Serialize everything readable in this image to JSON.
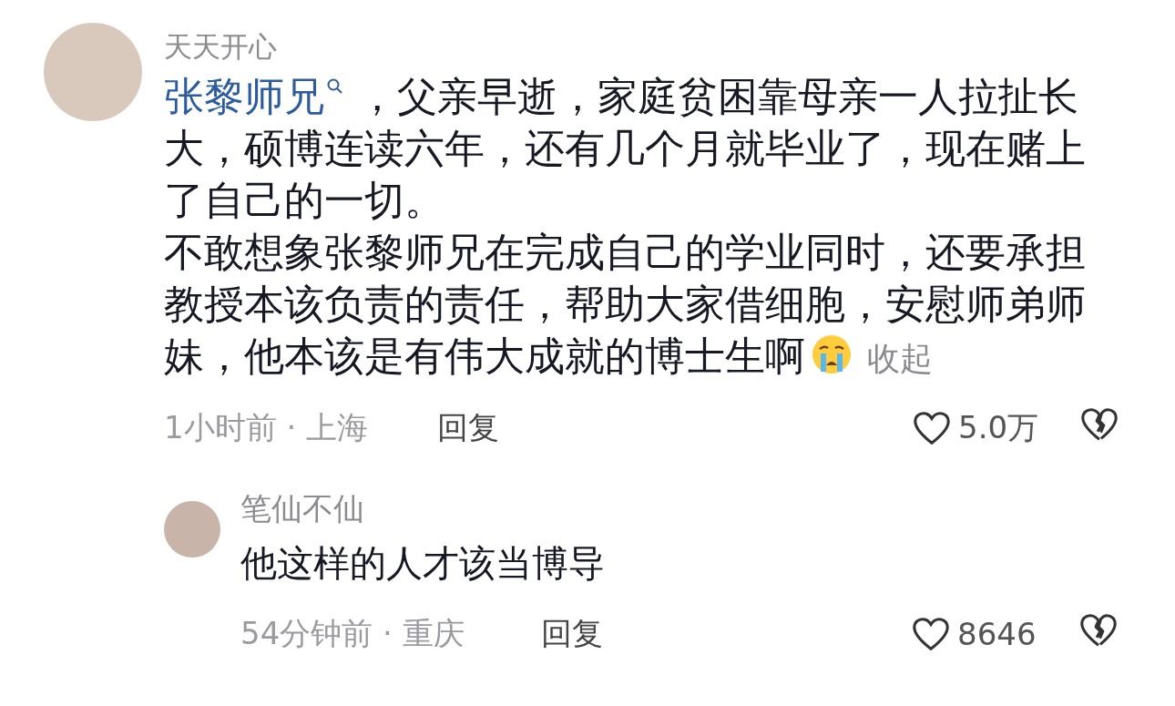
{
  "comment": {
    "username": "天天开心",
    "mention": "张黎师兄",
    "body": " ，父亲早逝，家庭贫困靠母亲一人拉扯长大，硕博连读六年，还有几个月就毕业了，现在赌上了自己的一切。",
    "body_2": "不敢想象张黎师兄在完成自己的学业同时，还要承担教授本该负责的责任，帮助大家借细胞，安慰师弟师妹，他本该是有伟大成就的博士生啊",
    "collapse_link": "收起",
    "time_location": "1小时前 · 上海",
    "reply_button": "回复",
    "like_count": "5.0万"
  },
  "reply": {
    "username": "笔仙不仙",
    "body": "他这样的人才该当博导",
    "time_location": "54分钟前 · 重庆",
    "reply_button": "回复",
    "like_count": "8646"
  }
}
